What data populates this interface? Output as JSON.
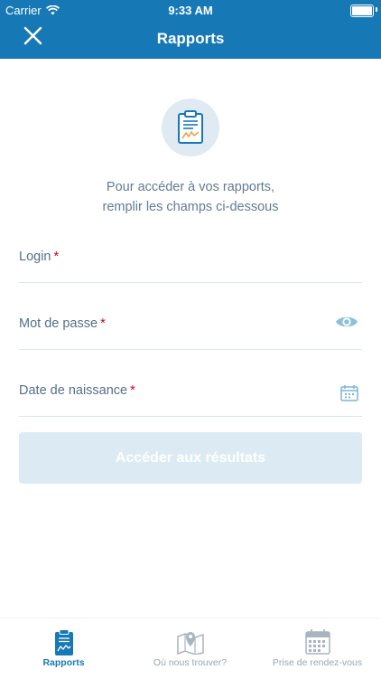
{
  "status_bar": {
    "carrier": "Carrier",
    "time": "9:33 AM"
  },
  "header": {
    "title": "Rapports",
    "close_icon": "close-icon"
  },
  "intro": {
    "line1": "Pour accéder à vos rapports,",
    "line2": "remplir les champs ci-dessous"
  },
  "form": {
    "login": {
      "label": "Login",
      "required_mark": "*",
      "value": ""
    },
    "password": {
      "label": "Mot de passe",
      "required_mark": "*",
      "value": "",
      "icon": "eye-icon"
    },
    "birthdate": {
      "label": "Date de naissance",
      "required_mark": "*",
      "value": "",
      "icon": "calendar-icon"
    },
    "submit_label": "Accéder aux résultats"
  },
  "tabs": [
    {
      "label": "Rapports",
      "icon": "report-icon",
      "active": true
    },
    {
      "label": "Où nous trouver?",
      "icon": "map-icon",
      "active": false
    },
    {
      "label": "Prise de rendez-vous",
      "icon": "calendar-icon",
      "active": false
    }
  ],
  "colors": {
    "primary": "#1679b6",
    "label": "#557089",
    "required": "#d0021b",
    "button_disabled": "#dcebf3",
    "accent_orange": "#f0a04b"
  }
}
